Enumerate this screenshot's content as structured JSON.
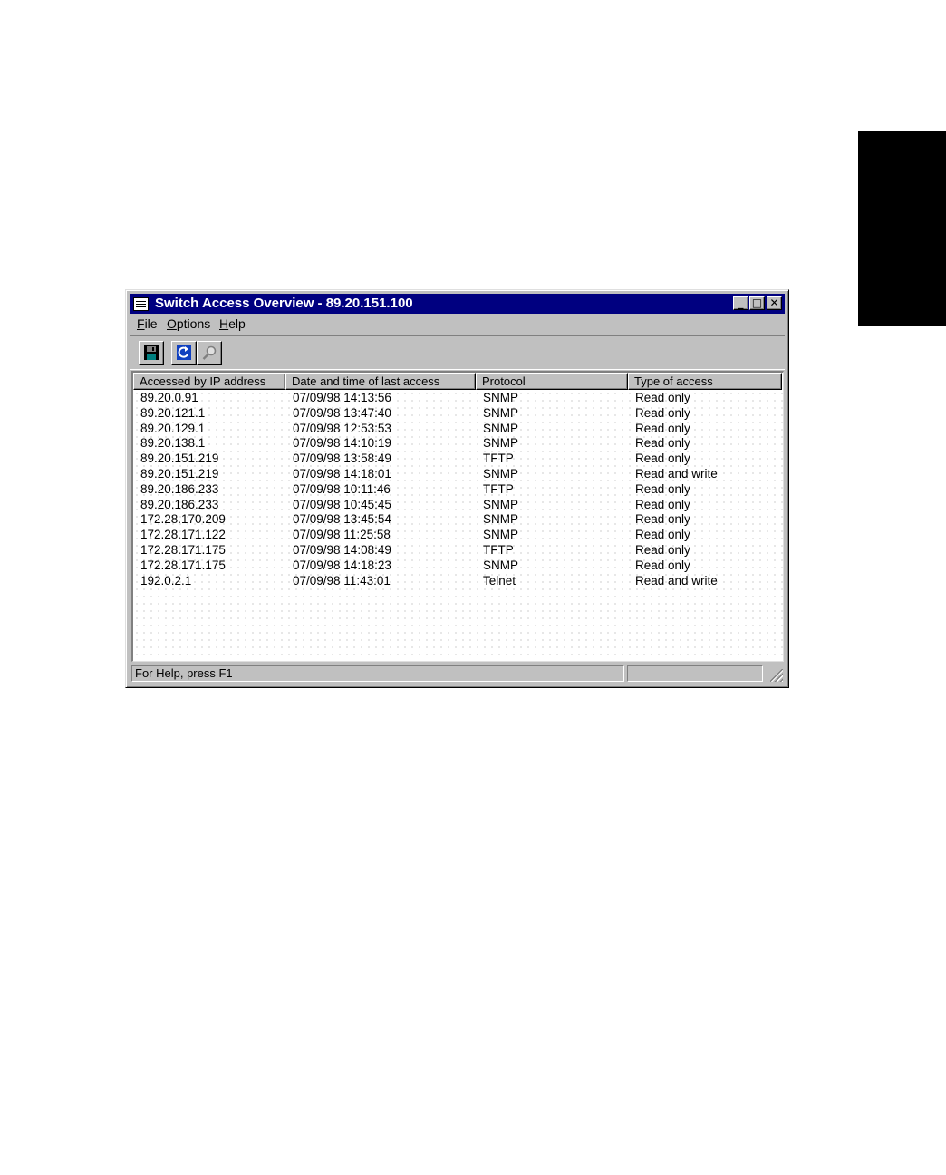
{
  "window": {
    "title": "Switch Access Overview - 89.20.151.100",
    "minimize_glyph": "_",
    "maximize_glyph": "□",
    "close_glyph": "✕"
  },
  "menu": [
    {
      "label": "File"
    },
    {
      "label": "Options"
    },
    {
      "label": "Help"
    }
  ],
  "toolbar": {
    "buttons": [
      {
        "icon": "save-disk-icon"
      },
      {
        "icon": "refresh-icon"
      },
      {
        "icon": "search-magnifier-icon"
      }
    ]
  },
  "table": {
    "columns": [
      "Accessed by IP address",
      "Date and time of last access",
      "Protocol",
      "Type of access"
    ],
    "rows": [
      [
        "89.20.0.91",
        "07/09/98 14:13:56",
        "SNMP",
        "Read only"
      ],
      [
        "89.20.121.1",
        "07/09/98 13:47:40",
        "SNMP",
        "Read only"
      ],
      [
        "89.20.129.1",
        "07/09/98 12:53:53",
        "SNMP",
        "Read only"
      ],
      [
        "89.20.138.1",
        "07/09/98 14:10:19",
        "SNMP",
        "Read only"
      ],
      [
        "89.20.151.219",
        "07/09/98 13:58:49",
        "TFTP",
        "Read only"
      ],
      [
        "89.20.151.219",
        "07/09/98 14:18:01",
        "SNMP",
        "Read and write"
      ],
      [
        "89.20.186.233",
        "07/09/98 10:11:46",
        "TFTP",
        "Read only"
      ],
      [
        "89.20.186.233",
        "07/09/98 10:45:45",
        "SNMP",
        "Read only"
      ],
      [
        "172.28.170.209",
        "07/09/98 13:45:54",
        "SNMP",
        "Read only"
      ],
      [
        "172.28.171.122",
        "07/09/98 11:25:58",
        "SNMP",
        "Read only"
      ],
      [
        "172.28.171.175",
        "07/09/98 14:08:49",
        "TFTP",
        "Read only"
      ],
      [
        "172.28.171.175",
        "07/09/98 14:18:23",
        "SNMP",
        "Read only"
      ],
      [
        "192.0.2.1",
        "07/09/98 11:43:01",
        "Telnet",
        "Read and write"
      ]
    ]
  },
  "statusbar": {
    "help_text": "For Help, press F1"
  },
  "colors": {
    "titlebar": "#000080",
    "face": "#c0c0c0",
    "side_tab": "#000000"
  }
}
